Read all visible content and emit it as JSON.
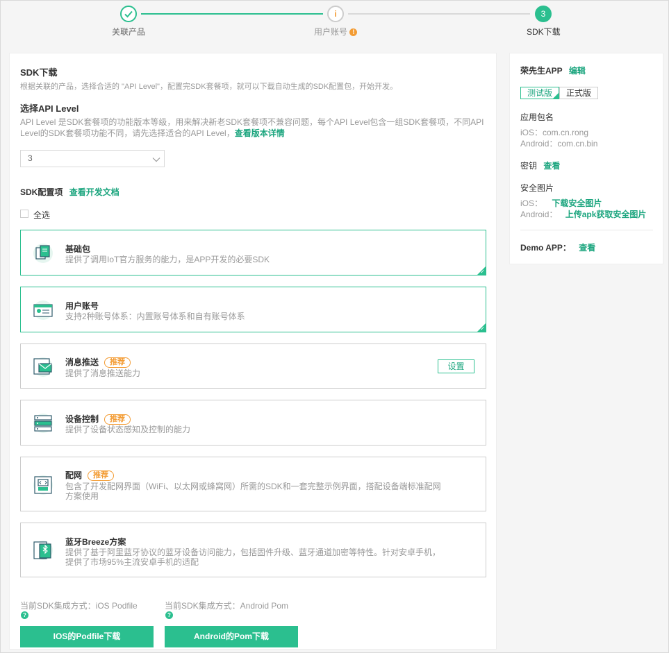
{
  "steps": [
    {
      "label": "关联产品",
      "status": "done"
    },
    {
      "label": "用户账号",
      "status": "warning"
    },
    {
      "label": "SDK下载",
      "status": "current",
      "number": "3"
    }
  ],
  "main": {
    "sdk_title": "SDK下载",
    "sdk_desc": "根据关联的产品，选择合适的 \"API Level\"，配置完SDK套餐项，就可以下载自动生成的SDK配置包，开始开发。",
    "api_title": "选择API Level",
    "api_desc_line1": "API Level 是SDK套餐项的功能版本等级，用来解决新老SDK套餐项不兼容问题，每个API Level包含一组SDK套餐项，不同API",
    "api_desc_line2": "Level的SDK套餐项功能不同，请先选择适合的API Level，",
    "api_link": "查看版本详情",
    "api_level_value": "3",
    "config_title": "SDK配置项",
    "config_link": "查看开发文档",
    "select_all": "全选",
    "cards": [
      {
        "title": "基础包",
        "desc": [
          "提供了调用IoT官方服务的能力，是APP开发的必要SDK"
        ],
        "badge": "",
        "selected": true
      },
      {
        "title": "用户账号",
        "desc": [
          "支持2种账号体系：内置账号体系和自有账号体系"
        ],
        "badge": "",
        "selected": true
      },
      {
        "title": "消息推送",
        "desc": [
          "提供了消息推送能力"
        ],
        "badge": "推荐",
        "selected": false,
        "action": "设置"
      },
      {
        "title": "设备控制",
        "desc": [
          "提供了设备状态感知及控制的能力"
        ],
        "badge": "推荐",
        "selected": false
      },
      {
        "title": "配网",
        "desc": [
          "包含了开发配网界面（WiFi、以太网或蜂窝网）所需的SDK和一套完整示例界面，搭配设备端标准配网",
          "方案使用"
        ],
        "badge": "推荐",
        "selected": false
      },
      {
        "title": "蓝牙Breeze方案",
        "desc": [
          "提供了基于阿里蓝牙协议的蓝牙设备访问能力，包括固件升级、蓝牙通道加密等特性。针对安卓手机，",
          "提供了市场95%主流安卓手机的适配"
        ],
        "badge": "",
        "selected": false
      }
    ],
    "ios_method": "当前SDK集成方式：iOS Podfile",
    "android_method": "当前SDK集成方式：Android Pom",
    "ios_button": "IOS的Podfile下载",
    "android_button": "Android的Pom下载"
  },
  "side": {
    "app_name": "荣先生APP",
    "edit_link": "编辑",
    "env_test": "测试版",
    "env_prod": "正式版",
    "package_title": "应用包名",
    "ios_package": "iOS：com.cn.rong",
    "android_package": "Android：com.cn.bin",
    "secret_title": "密钥",
    "secret_link": "查看",
    "security_title": "安全图片",
    "ios_label": "iOS：",
    "ios_link": "下载安全图片",
    "android_label": "Android：",
    "android_link": "上传apk获取安全图片",
    "demo_title": "Demo APP：",
    "demo_link": "查看"
  },
  "colors": {
    "accent": "#2bbf8f",
    "accent_text": "#1ba57e",
    "warning": "#f39c34"
  }
}
